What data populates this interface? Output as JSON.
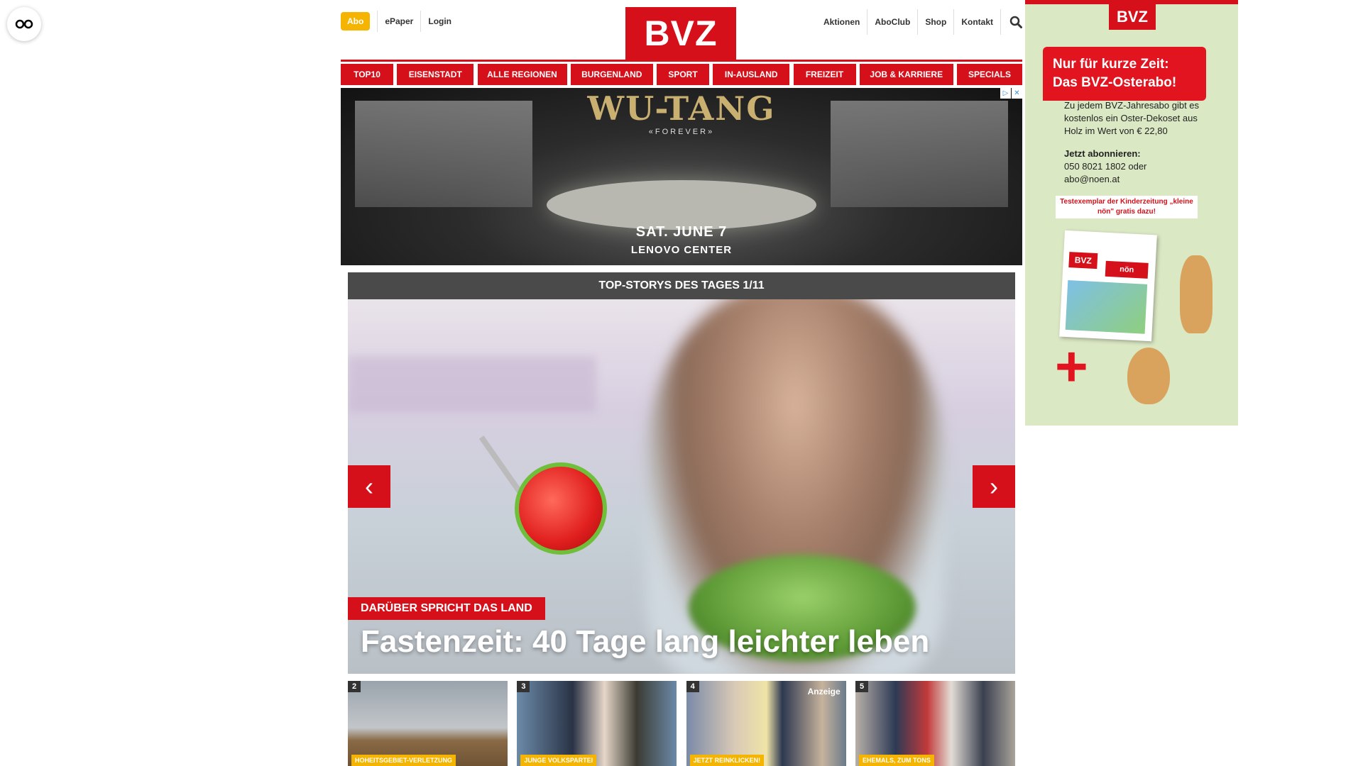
{
  "header": {
    "abo_label": "Abo",
    "epaper_label": "ePaper",
    "login_label": "Login",
    "logo_text": "BVZ",
    "right_links": [
      "Aktionen",
      "AboClub",
      "Shop",
      "Kontakt"
    ]
  },
  "nav": {
    "items": [
      "TOP10",
      "EISENSTADT",
      "ALLE REGIONEN",
      "BURGENLAND",
      "SPORT",
      "IN-AUSLAND",
      "FREIZEIT",
      "JOB & KARRIERE",
      "SPECIALS"
    ]
  },
  "top_ad": {
    "title": "WU-TANG",
    "subtitle": "«FOREVER»",
    "date": "SAT. JUNE 7",
    "venue": "LENOVO CENTER"
  },
  "top_stories": {
    "heading": "TOP-STORYS DES TAGES 1/11",
    "hero_kicker": "DARÜBER SPRICHT DAS LAND",
    "hero_title": "Fastenzeit: 40 Tage lang leichter leben",
    "thumbs": [
      {
        "num": "2",
        "tag": "HOHEITSGEBIET-VERLETZUNG",
        "anzeige": ""
      },
      {
        "num": "3",
        "tag": "JUNGE VOLKSPARTEI",
        "anzeige": ""
      },
      {
        "num": "4",
        "tag": "JETZT REINKLICKEN!",
        "anzeige": "Anzeige"
      },
      {
        "num": "5",
        "tag": "EHEMALS, ZUM TONS",
        "anzeige": ""
      }
    ]
  },
  "side_ad": {
    "logo": "BVZ",
    "headline_1": "Nur für kurze Zeit:",
    "headline_2": "Das BVZ-Osterabo!",
    "body": "Zu jedem BVZ-Jahresabo gibt es kostenlos ein Oster-Dekoset aus Holz im Wert von € 22,80",
    "cta_title": "Jetzt abonnieren:",
    "cta_phone": "050 8021 1802 oder",
    "cta_email": "abo@noen.at",
    "promo": "Testexemplar der Kinderzeitung „kleine nön\" gratis dazu!",
    "mag_logo_1": "BVZ",
    "mag_logo_2": "nön"
  },
  "colors": {
    "brand_red": "#d6101a",
    "abo_yellow": "#f4b400",
    "heading_gray": "#4a4a4a"
  }
}
